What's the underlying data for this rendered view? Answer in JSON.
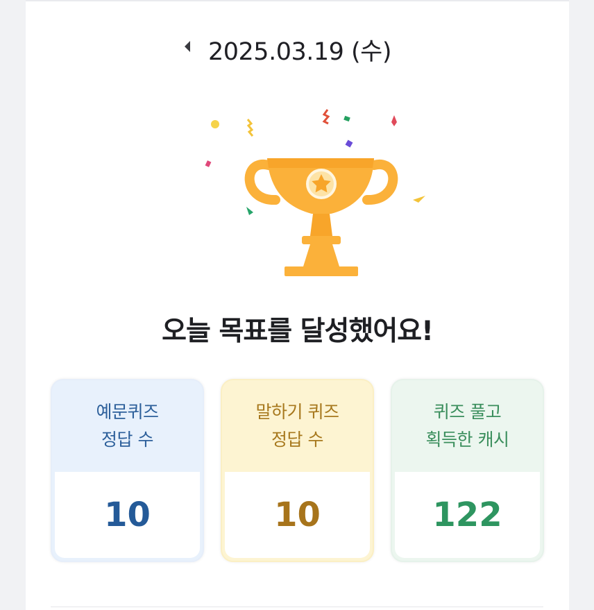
{
  "date": {
    "text": "2025.03.19 (수)",
    "prev_icon": "caret-left-icon"
  },
  "trophy": {
    "icon": "trophy-icon",
    "colors": {
      "gold": "#fbb13a",
      "dark_gold": "#f5a021",
      "light": "#ffd166"
    }
  },
  "headline": "오늘 목표를 달성했어요!",
  "stats": [
    {
      "label_line1": "예문퀴즈",
      "label_line2": "정답 수",
      "value": "10",
      "color": "#245a98",
      "bg": "#e8f1fc"
    },
    {
      "label_line1": "말하기 퀴즈",
      "label_line2": "정답 수",
      "value": "10",
      "color": "#a7741b",
      "bg": "#fdf4d2"
    },
    {
      "label_line1": "퀴즈 풀고",
      "label_line2": "획득한 캐시",
      "value": "122",
      "color": "#2e9560",
      "bg": "#ecf6ef"
    }
  ]
}
